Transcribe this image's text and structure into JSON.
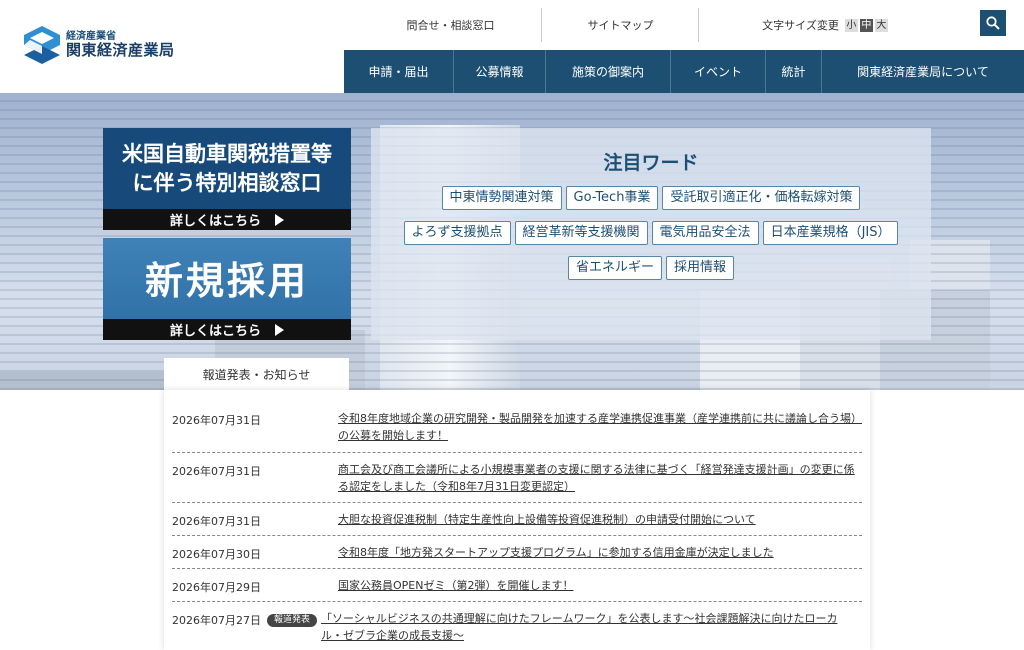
{
  "header": {
    "logo_sub": "経済産業省",
    "logo_main": "関東経済産業局",
    "utility": {
      "contact": "問合せ・相談窓口",
      "sitemap": "サイトマップ",
      "font_size_label": "文字サイズ変更",
      "font_small": "小",
      "font_medium": "中",
      "font_large": "大"
    },
    "search_icon": "search-icon",
    "nav": [
      "申請・届出",
      "公募情報",
      "施策の御案内",
      "イベント",
      "統計",
      "関東経済産業局について"
    ]
  },
  "banners": [
    {
      "title_line1": "米国自動車関税措置等",
      "title_line2": "に伴う特別相談窓口",
      "link": "詳しくはこちら"
    },
    {
      "title": "新規採用",
      "link": "詳しくはこちら"
    }
  ],
  "keywords": {
    "title": "注目ワード",
    "rows": [
      [
        "中東情勢関連対策",
        "Go-Tech事業",
        "受託取引適正化・価格転嫁対策"
      ],
      [
        "よろず支援拠点",
        "経営革新等支援機関",
        "電気用品安全法",
        "日本産業規格（JIS）"
      ],
      [
        "省エネルギー",
        "採用情報"
      ]
    ]
  },
  "news": {
    "tab_label": "報道発表・お知らせ",
    "items": [
      {
        "date": "2026年07月31日",
        "badge": "",
        "title": "令和8年度地域企業の研究開発・製品開発を加速する産学連携促進事業（産学連携前に共に議論し合う場）の公募を開始します！"
      },
      {
        "date": "2026年07月31日",
        "badge": "",
        "title": "商工会及び商工会議所による小規模事業者の支援に関する法律に基づく「経営発達支援計画」の変更に係る認定をしました（令和8年7月31日変更認定）"
      },
      {
        "date": "2026年07月31日",
        "badge": "",
        "title": "大胆な投資促進税制（特定生産性向上設備等投資促進税制）の申請受付開始について"
      },
      {
        "date": "2026年07月30日",
        "badge": "",
        "title": "令和8年度「地方発スタートアップ支援プログラム」に参加する信用金庫が決定しました"
      },
      {
        "date": "2026年07月29日",
        "badge": "",
        "title": "国家公務員OPENゼミ（第2弾）を開催します！"
      },
      {
        "date": "2026年07月27日",
        "badge": "報道発表",
        "title": "「ソーシャルビジネスの共通理解に向けたフレームワーク」を公表します～社会課題解決に向けたローカル・ゼブラ企業の成長支援～"
      }
    ]
  },
  "colors": {
    "brand": "#1d4f73",
    "banner_dark": "#174a7a",
    "banner_light": "#3f82b7"
  }
}
